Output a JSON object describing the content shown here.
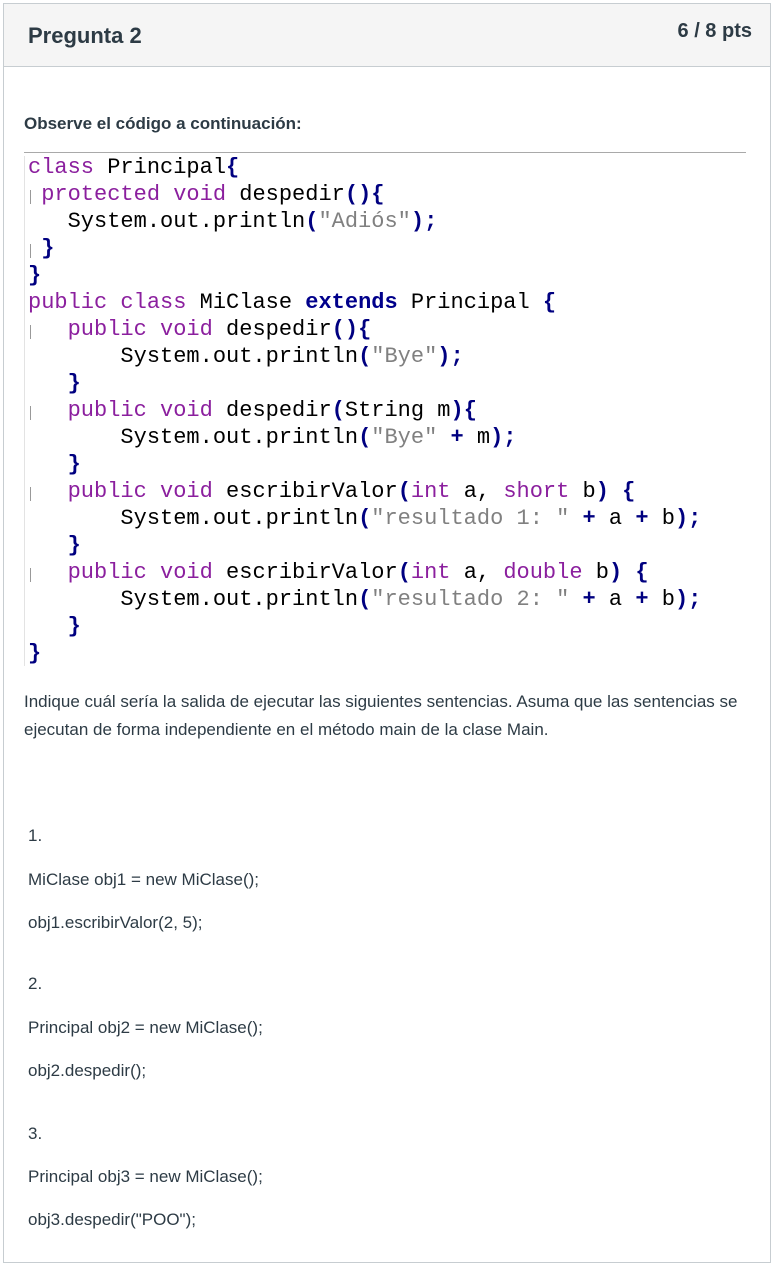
{
  "question": {
    "title": "Pregunta 2",
    "points": "6 / 8 pts"
  },
  "intro": "Observe el código a continuación:",
  "code_lines": [
    [
      [
        "kw",
        "class"
      ],
      [
        "id",
        " Principal"
      ],
      [
        "op",
        "{"
      ]
    ],
    [
      [
        "id",
        " "
      ],
      [
        "kw",
        "protected"
      ],
      [
        "id",
        " "
      ],
      [
        "kw",
        "void"
      ],
      [
        "id",
        " despedir"
      ],
      [
        "op",
        "(){"
      ]
    ],
    [
      [
        "id",
        "   System.out.println"
      ],
      [
        "op",
        "("
      ],
      [
        "str",
        "\"Adiós\""
      ],
      [
        "op",
        ");"
      ]
    ],
    [
      [
        "id",
        " "
      ],
      [
        "op",
        "}"
      ]
    ],
    [
      [
        "op",
        "}"
      ]
    ],
    [
      [
        "kw",
        "public"
      ],
      [
        "id",
        " "
      ],
      [
        "kw",
        "class"
      ],
      [
        "id",
        " MiClase "
      ],
      [
        "kwb",
        "extends"
      ],
      [
        "id",
        " Principal "
      ],
      [
        "op",
        "{"
      ]
    ],
    [
      [
        "id",
        "   "
      ],
      [
        "kw",
        "public"
      ],
      [
        "id",
        " "
      ],
      [
        "kw",
        "void"
      ],
      [
        "id",
        " despedir"
      ],
      [
        "op",
        "(){"
      ]
    ],
    [
      [
        "id",
        "       System.out.println"
      ],
      [
        "op",
        "("
      ],
      [
        "str",
        "\"Bye\""
      ],
      [
        "op",
        ");"
      ]
    ],
    [
      [
        "id",
        "   "
      ],
      [
        "op",
        "}"
      ]
    ],
    [
      [
        "id",
        "   "
      ],
      [
        "kw",
        "public"
      ],
      [
        "id",
        " "
      ],
      [
        "kw",
        "void"
      ],
      [
        "id",
        " despedir"
      ],
      [
        "op",
        "("
      ],
      [
        "id",
        "String m"
      ],
      [
        "op",
        "){"
      ]
    ],
    [
      [
        "id",
        "       System.out.println"
      ],
      [
        "op",
        "("
      ],
      [
        "str",
        "\"Bye\""
      ],
      [
        "id",
        " "
      ],
      [
        "op",
        "+"
      ],
      [
        "id",
        " m"
      ],
      [
        "op",
        ");"
      ]
    ],
    [
      [
        "id",
        "   "
      ],
      [
        "op",
        "}"
      ]
    ],
    [
      [
        "id",
        "   "
      ],
      [
        "kw",
        "public"
      ],
      [
        "id",
        " "
      ],
      [
        "kw",
        "void"
      ],
      [
        "id",
        " escribirValor"
      ],
      [
        "op",
        "("
      ],
      [
        "kw",
        "int"
      ],
      [
        "id",
        " a, "
      ],
      [
        "kw",
        "short"
      ],
      [
        "id",
        " b"
      ],
      [
        "op",
        ")"
      ],
      [
        "id",
        " "
      ],
      [
        "op",
        "{"
      ]
    ],
    [
      [
        "id",
        "       System.out.println"
      ],
      [
        "op",
        "("
      ],
      [
        "str",
        "\"resultado 1: \""
      ],
      [
        "id",
        " "
      ],
      [
        "op",
        "+"
      ],
      [
        "id",
        " a "
      ],
      [
        "op",
        "+"
      ],
      [
        "id",
        " b"
      ],
      [
        "op",
        ");"
      ]
    ],
    [
      [
        "id",
        "   "
      ],
      [
        "op",
        "}"
      ]
    ],
    [
      [
        "id",
        "   "
      ],
      [
        "kw",
        "public"
      ],
      [
        "id",
        " "
      ],
      [
        "kw",
        "void"
      ],
      [
        "id",
        " escribirValor"
      ],
      [
        "op",
        "("
      ],
      [
        "kw",
        "int"
      ],
      [
        "id",
        " a, "
      ],
      [
        "kw",
        "double"
      ],
      [
        "id",
        " b"
      ],
      [
        "op",
        ")"
      ],
      [
        "id",
        " "
      ],
      [
        "op",
        "{"
      ]
    ],
    [
      [
        "id",
        "       System.out.println"
      ],
      [
        "op",
        "("
      ],
      [
        "str",
        "\"resultado 2: \""
      ],
      [
        "id",
        " "
      ],
      [
        "op",
        "+"
      ],
      [
        "id",
        " a "
      ],
      [
        "op",
        "+"
      ],
      [
        "id",
        " b"
      ],
      [
        "op",
        ");"
      ]
    ],
    [
      [
        "id",
        "   "
      ],
      [
        "op",
        "}"
      ]
    ],
    [
      [
        "op",
        "}"
      ]
    ]
  ],
  "description": "Indique cuál sería la salida de ejecutar las siguientes sentencias. Asuma que las sentencias se ejecutan de forma independiente en el método main de la clase Main.",
  "items": [
    {
      "number": "1.",
      "lines": [
        "MiClase obj1 = new MiClase();",
        "obj1.escribirValor(2, 5);"
      ]
    },
    {
      "number": "2.",
      "lines": [
        "Principal obj2 = new MiClase();",
        "obj2.despedir();"
      ]
    },
    {
      "number": "3.",
      "lines": [
        "Principal obj3 = new MiClase();",
        "obj3.despedir(\"POO\");"
      ]
    }
  ]
}
